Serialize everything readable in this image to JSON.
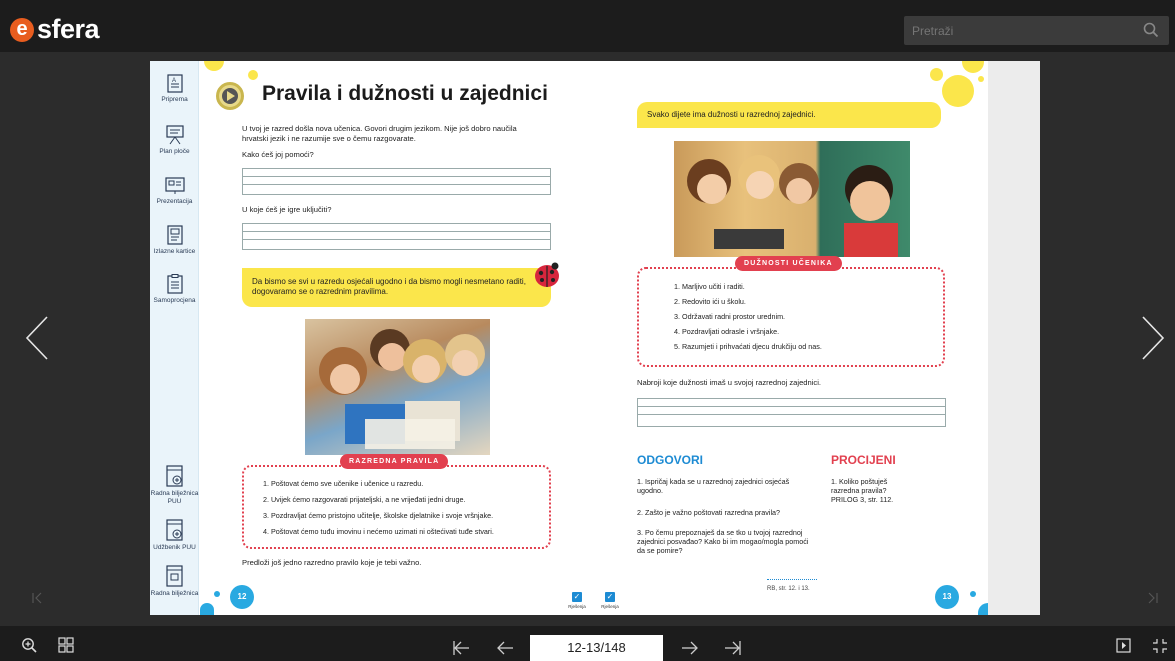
{
  "app": {
    "logo_letter": "e",
    "logo_text": "sfera"
  },
  "search": {
    "placeholder": "Pretraži",
    "icon": "search-icon"
  },
  "sidebar": {
    "top_items": [
      {
        "label": "Priprema",
        "icon": "document-icon"
      },
      {
        "label": "Plan ploče",
        "icon": "board-icon"
      },
      {
        "label": "Prezentacija",
        "icon": "presentation-icon"
      },
      {
        "label": "Izlazne kartice",
        "icon": "cards-icon"
      },
      {
        "label": "Samoprocjena",
        "icon": "checklist-icon"
      }
    ],
    "bottom_items": [
      {
        "label": "Radna bilježnica PUU",
        "icon": "workbook-add-icon"
      },
      {
        "label": "Udžbenik PUU",
        "icon": "textbook-add-icon"
      },
      {
        "label": "Radna bilježnica",
        "icon": "workbook-icon"
      }
    ]
  },
  "left_page": {
    "title": "Pravila i dužnosti u zajednici",
    "intro": "U tvoj je razred došla nova učenica. Govori drugim jezikom. Nije još dobro naučila hrvatski jezik i ne razumije sve o čemu razgovarate.",
    "q1": "Kako ćeš joj pomoći?",
    "q2": "U koje ćeš je igre uključiti?",
    "callout": "Da bismo se svi u razredu osjećali ugodno i da bismo mogli nesmetano raditi, dogovaramo se o razrednim pravilima.",
    "badge": "RAZREDNA PRAVILA",
    "rules": [
      "1. Poštovat ćemo sve učenike i učenice u razredu.",
      "2. Uvijek ćemo razgovarati prijateljski, a ne vrijeđati jedni druge.",
      "3. Pozdravljat ćemo pristojno učitelje, školske djelatnike i svoje vršnjake.",
      "4. Poštovat ćemo tuđu imovinu i nećemo uzimati ni oštećivati tuđe stvari."
    ],
    "footer_prompt": "Predloži još jedno razredno pravilo koje je tebi važno.",
    "page_number": "12"
  },
  "right_page": {
    "callout": "Svako dijete ima dužnosti u razrednoj zajednici.",
    "badge": "DUŽNOSTI UČENIKA",
    "duties": [
      "1. Marljivo učiti i raditi.",
      "2. Redovito ići u školu.",
      "3. Održavati radni prostor urednim.",
      "4. Pozdravljati odrasle i vršnjake.",
      "5. Razumjeti i prihvaćati djecu drukčiju od nas."
    ],
    "prompt": "Nabroji koje dužnosti imaš u svojoj razrednoj zajednici.",
    "answers_title": "ODGOVORI",
    "answers": [
      "1. Ispričaj kada se u razrednoj zajednici osjećaš ugodno.",
      "2. Zašto je važno poštovati razredna pravila?",
      "3. Po čemu prepoznaješ da se tko u tvojoj razrednoj zajednici posvađao? Kako bi im mogao/mogla pomoći da se pomire?"
    ],
    "assess_title": "PROCIJENI",
    "assess": "1. Koliko poštuješ razredna pravila? PRILOG 3, str. 112.",
    "ref": "RB, str. 12. i 13.",
    "page_number": "13"
  },
  "solutions": [
    {
      "label": "Rješenja"
    },
    {
      "label": "Rješenja"
    }
  ],
  "pager": {
    "indicator": "12-13/148"
  },
  "colors": {
    "accent_yellow": "#fbe64b",
    "accent_red": "#e2404f",
    "accent_blue": "#29a9e1",
    "odgovori": "#1d8bd3",
    "procijeni": "#e2404f"
  }
}
